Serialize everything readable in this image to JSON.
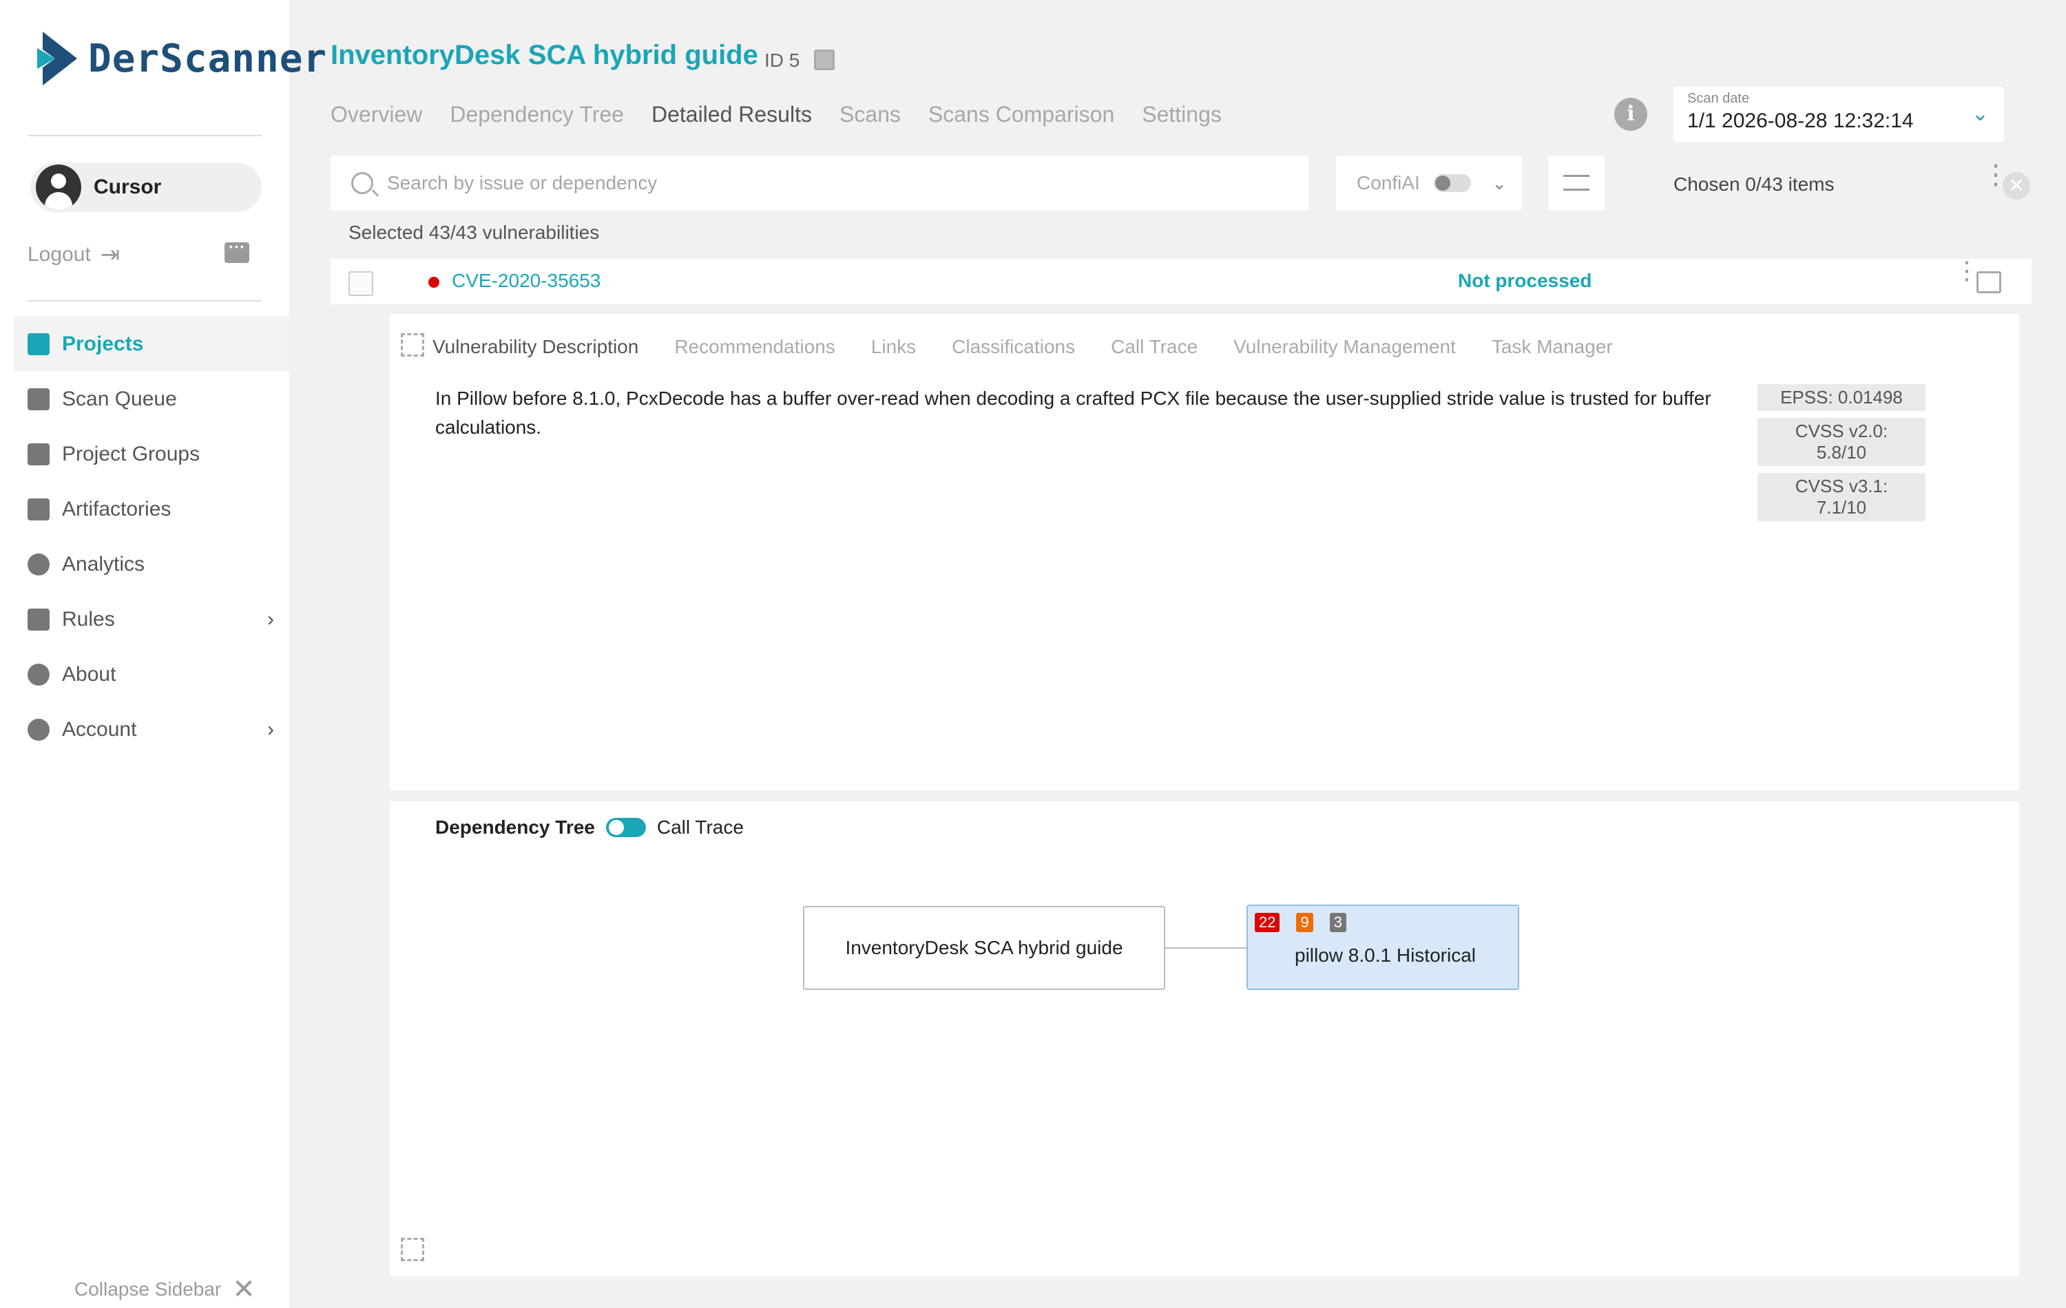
{
  "colors": {
    "accent": "#1aa6b7",
    "critical": "#dd0000",
    "high": "#ee6b00",
    "medium": "#777777"
  },
  "sidebar": {
    "logo_text": "DerScanner",
    "user_name": "Cursor",
    "logout_label": "Logout",
    "items": [
      {
        "label": "Projects",
        "icon": "file-icon",
        "active": true
      },
      {
        "label": "Scan Queue",
        "icon": "scan-queue-icon"
      },
      {
        "label": "Project Groups",
        "icon": "folder-icon"
      },
      {
        "label": "Artifactories",
        "icon": "cube-icon"
      },
      {
        "label": "Analytics",
        "icon": "pie-chart-icon"
      },
      {
        "label": "Rules",
        "icon": "clipboard-icon",
        "has_submenu": true
      },
      {
        "label": "About",
        "icon": "info-icon"
      },
      {
        "label": "Account",
        "icon": "user-circle-icon",
        "has_submenu": true
      }
    ],
    "collapse_label": "Collapse Sidebar"
  },
  "header": {
    "title": "InventoryDesk SCA hybrid guide",
    "id_label": "ID 5",
    "tabs": [
      "Overview",
      "Dependency Tree",
      "Detailed Results",
      "Scans",
      "Scans Comparison",
      "Settings"
    ],
    "active_tab": "Detailed Results",
    "scan_date_label": "Scan date",
    "scan_date_value": "1/1 2026-08-28 12:32:14"
  },
  "toolbar": {
    "search_placeholder": "Search by issue or dependency",
    "confiai_label": "ConfiAI",
    "chosen_label": "Chosen 0/43 items",
    "selected_info": "Selected 43/43 vulnerabilities"
  },
  "vulnerability": {
    "id": "CVE-2020-35653",
    "status": "Not processed",
    "tabs": [
      "Vulnerability Description",
      "Recommendations",
      "Links",
      "Classifications",
      "Call Trace",
      "Vulnerability Management",
      "Task Manager"
    ],
    "active_tab": "Vulnerability Description",
    "description": "In Pillow before 8.1.0, PcxDecode has a buffer over-read when decoding a crafted PCX file because the user-supplied stride value is trusted for buffer calculations.",
    "scores": [
      "EPSS: 0.01498",
      "CVSS v2.0: 5.8/10",
      "CVSS v3.1: 7.1/10"
    ]
  },
  "tree": {
    "title": "Dependency Tree",
    "toggle_label": "Call Trace",
    "root_node": "InventoryDesk SCA hybrid guide",
    "dep_node": "pillow 8.0.1 Historical",
    "badges": [
      "22",
      "9",
      "3"
    ]
  }
}
